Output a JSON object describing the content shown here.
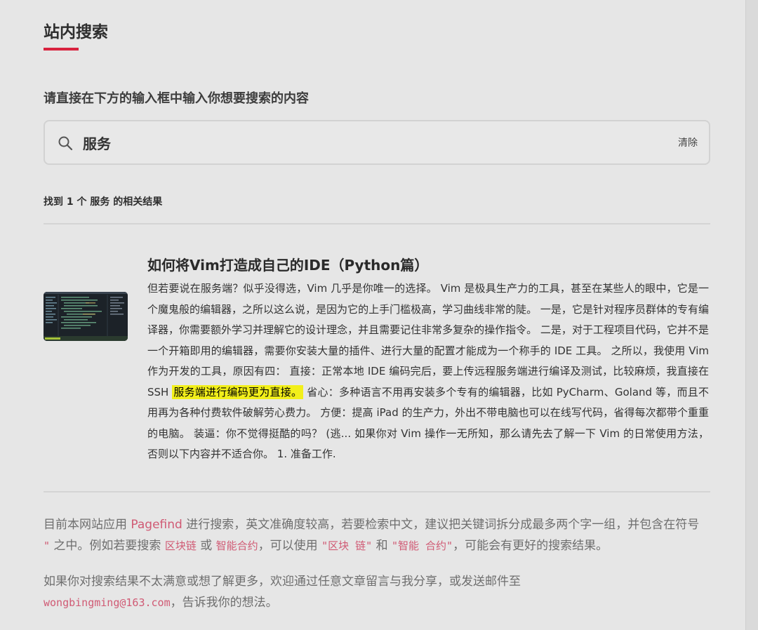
{
  "page": {
    "title": "站内搜索",
    "prompt": "请直接在下方的输入框中输入你想要搜索的内容"
  },
  "search": {
    "query": "服务",
    "clear_label": "清除",
    "icon": "search-icon"
  },
  "results": {
    "count_prefix": "找到",
    "count": "1",
    "count_mid": "个",
    "term": "服务",
    "count_suffix": "的相关结果",
    "items": [
      {
        "title": "如何将Vim打造成自己的IDE（Python篇）",
        "excerpt_before": "但若要说在服务端？似乎没得选，Vim 几乎是你唯一的选择。 Vim 是极具生产力的工具，甚至在某些人的眼中，它是一个魔鬼般的编辑器，之所以这么说，是因为它的上手门槛极高，学习曲线非常的陡。 一是，它是针对程序员群体的专有编译器，你需要额外学习并理解它的设计理念，并且需要记住非常多复杂的操作指令。 二是，对于工程项目代码，它并不是一个开箱即用的编辑器，需要你安装大量的插件、进行大量的配置才能成为一个称手的 IDE 工具。 之所以，我使用 Vim 作为开发的工具，原因有四： 直接：正常本地 IDE 编码完后，要上传远程服务端进行编译及测试，比较麻烦，我直接在 SSH ",
        "excerpt_highlight": "服务端进行编码更为直接。",
        "excerpt_after": " 省心：多种语言不用再安装多个专有的编辑器，比如 PyCharm、Goland 等，而且不用再为各种付费软件破解劳心费力。 方便：提高 iPad 的生产力，外出不带电脑也可以在线写代码，省得每次都带个重重的电脑。 装逼：你不觉得挺酷的吗？ (逃... 如果你对 Vim 操作一无所知，那么请先去了解一下 Vim 的日常使用方法，否则以下内容并不适合你。 1. 准备工作."
      }
    ]
  },
  "footer": {
    "note1_a": "目前本网站应用 ",
    "pagefind": "Pagefind",
    "note1_b": " 进行搜索，英文准确度较高，若要检索中文，建议把关键词拆分成最多两个字一组，并包含在符号 ",
    "quote_sym": "\"",
    "note1_c": " 之中。例如若要搜索 ",
    "ex1": "区块链",
    "or": " 或 ",
    "ex2": "智能合约",
    "note1_d": "，可以使用 ",
    "ex3": "\"区块 链\"",
    "and": " 和 ",
    "ex4": "\"智能 合约\"",
    "note1_e": "，可能会有更好的搜索结果。",
    "note2_a": "如果你对搜索结果不太满意或想了解更多，欢迎通过任意文章留言与我分享，或发送邮件至",
    "email": "wongbingming@163.com",
    "note2_b": "，告诉我你的想法。"
  },
  "colors": {
    "accent": "#d9233f",
    "highlight": "#f2ef1a",
    "link": "#d05a74"
  }
}
